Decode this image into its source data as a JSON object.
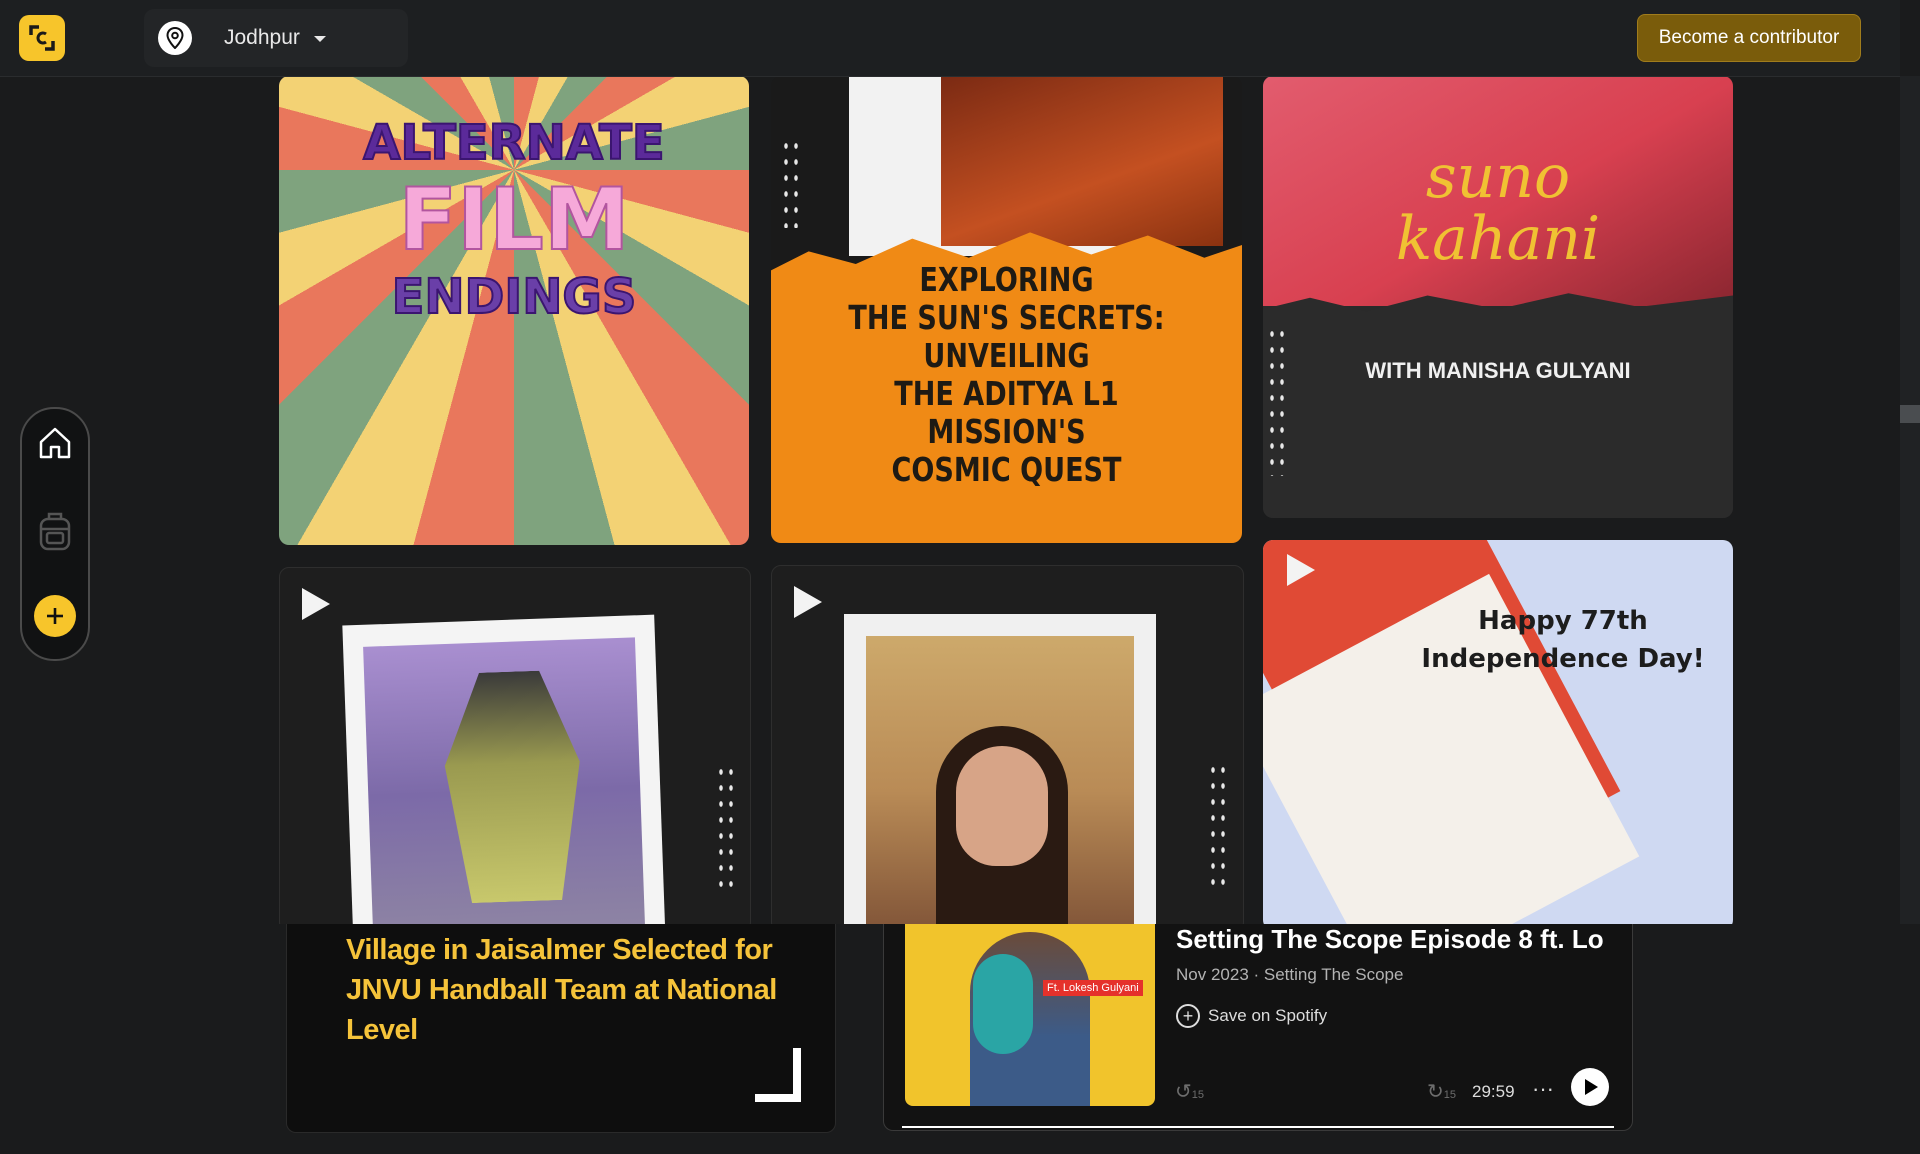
{
  "header": {
    "location": "Jodhpur",
    "contribute_label": "Become a contributor"
  },
  "icons": {
    "logo": "brand-logo-icon",
    "location": "map-pin-icon",
    "home": "home-icon",
    "bag": "backpack-icon",
    "add": "plus-icon"
  },
  "colors": {
    "accent": "#f7c52b",
    "contribute_bg": "#7a5c0b",
    "news_title": "#f5c33a"
  },
  "cards": {
    "film": {
      "line1": "ALTERNATE",
      "line2": "FILM",
      "line3": "ENDINGS"
    },
    "sun": {
      "lines": [
        "EXPLORING",
        "THE SUN'S SECRETS:",
        "UNVEILING",
        "THE ADITYA L1 MISSION'S",
        "COSMIC QUEST"
      ]
    },
    "suno": {
      "title1": "suno",
      "title2": "kahani",
      "subtitle": "WITH MANISHA GULYANI"
    },
    "independence": {
      "line1": "Happy 77th",
      "line2": "Independence Day!"
    }
  },
  "news": {
    "title": "Village in Jaisalmer Selected for JNVU Handball Team at National Level"
  },
  "spotify": {
    "art_label": "Ft. Lokesh Gulyani",
    "title": "Setting The Scope Episode 8 ft. Lo",
    "meta": "Nov 2023 · Setting The Scope",
    "save_label": "Save on Spotify",
    "rewind": "15",
    "forward": "15",
    "duration": "29:59",
    "more": "···"
  }
}
